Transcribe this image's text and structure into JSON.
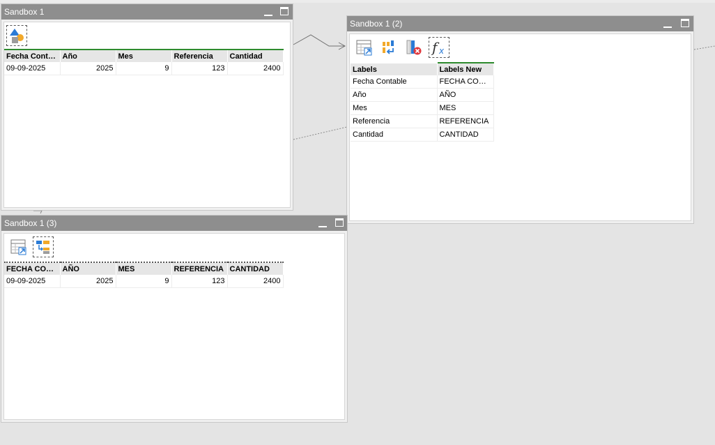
{
  "windows": {
    "w1": {
      "title": "Sandbox 1",
      "tools": [
        "shapes-icon"
      ],
      "columns": [
        "Fecha Conta...",
        "Año",
        "Mes",
        "Referencia",
        "Cantidad"
      ],
      "rows": [
        [
          "09-09-2025",
          "2025",
          "9",
          "123",
          "2400"
        ]
      ]
    },
    "w2": {
      "title": "Sandbox 1 (2)",
      "tools": [
        "table-link-icon",
        "column-move-icon",
        "column-delete-icon",
        "formula-fx-icon"
      ],
      "columns": [
        "Labels",
        "Labels New"
      ],
      "rows": [
        [
          "Fecha Contable",
          "FECHA CONT..."
        ],
        [
          "Año",
          "AÑO"
        ],
        [
          "Mes",
          "MES"
        ],
        [
          "Referencia",
          "REFERENCIA"
        ],
        [
          "Cantidad",
          "CANTIDAD"
        ]
      ]
    },
    "w3": {
      "title": "Sandbox 1 (3)",
      "tools": [
        "table-link-icon",
        "columns-rename-icon"
      ],
      "columns": [
        "FECHA CON...",
        "AÑO",
        "MES",
        "REFERENCIA",
        "CANTIDAD"
      ],
      "rows": [
        [
          "09-09-2025",
          "2025",
          "9",
          "123",
          "2400"
        ]
      ]
    }
  },
  "colors": {
    "titlebar": "#8e8e8e",
    "canvas": "#e4e4e4",
    "header_accent": "#2e8b2e"
  }
}
